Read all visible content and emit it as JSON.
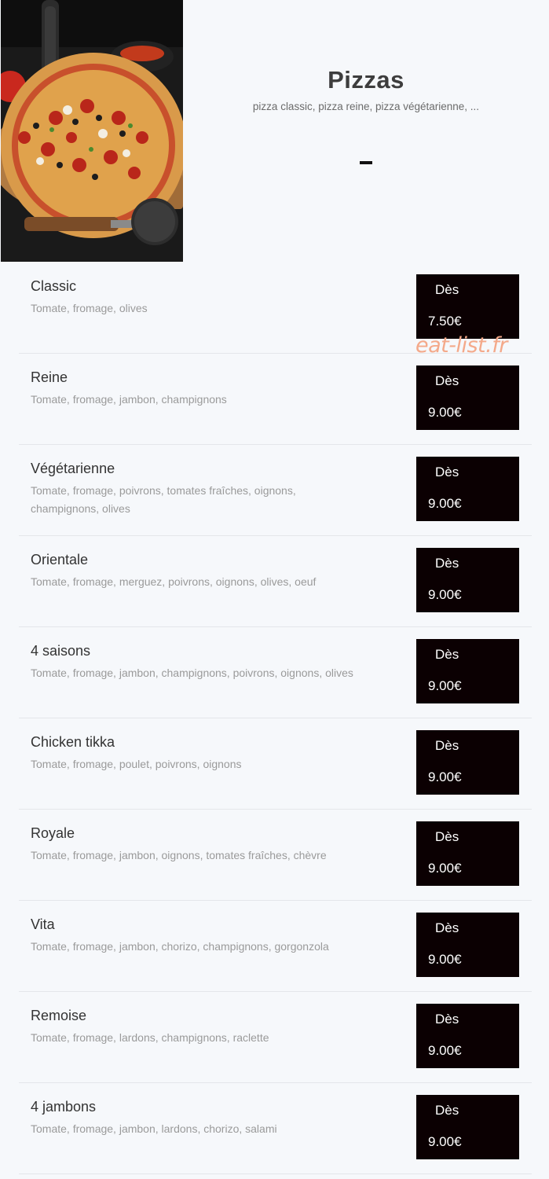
{
  "category": {
    "title": "Pizzas",
    "subtitle": "pizza classic, pizza reine, pizza végétarienne, ...",
    "dash": "-",
    "image_icon": "pizza-photo"
  },
  "watermark": "eat-list.fr",
  "items": [
    {
      "name": "Classic",
      "description": "Tomate, fromage, olives",
      "price_prefix": "Dès",
      "price": "7.50€"
    },
    {
      "name": "Reine",
      "description": "Tomate, fromage, jambon, champignons",
      "price_prefix": "Dès",
      "price": "9.00€"
    },
    {
      "name": "Végétarienne",
      "description": "Tomate, fromage, poivrons, tomates fraîches, oignons, champignons, olives",
      "price_prefix": "Dès",
      "price": "9.00€"
    },
    {
      "name": "Orientale",
      "description": "Tomate, fromage, merguez, poivrons, oignons, olives, oeuf",
      "price_prefix": "Dès",
      "price": "9.00€"
    },
    {
      "name": "4 saisons",
      "description": "Tomate, fromage, jambon, champignons, poivrons, oignons, olives",
      "price_prefix": "Dès",
      "price": "9.00€"
    },
    {
      "name": "Chicken tikka",
      "description": "Tomate, fromage, poulet, poivrons, oignons",
      "price_prefix": "Dès",
      "price": "9.00€"
    },
    {
      "name": "Royale",
      "description": "Tomate, fromage, jambon, oignons, tomates fraîches, chèvre",
      "price_prefix": "Dès",
      "price": "9.00€"
    },
    {
      "name": "Vita",
      "description": "Tomate, fromage, jambon, chorizo, champignons, gorgonzola",
      "price_prefix": "Dès",
      "price": "9.00€"
    },
    {
      "name": "Remoise",
      "description": "Tomate, fromage, lardons, champignons, raclette",
      "price_prefix": "Dès",
      "price": "9.00€"
    },
    {
      "name": "4 jambons",
      "description": "Tomate, fromage, jambon, lardons, chorizo, salami",
      "price_prefix": "Dès",
      "price": "9.00€"
    }
  ]
}
